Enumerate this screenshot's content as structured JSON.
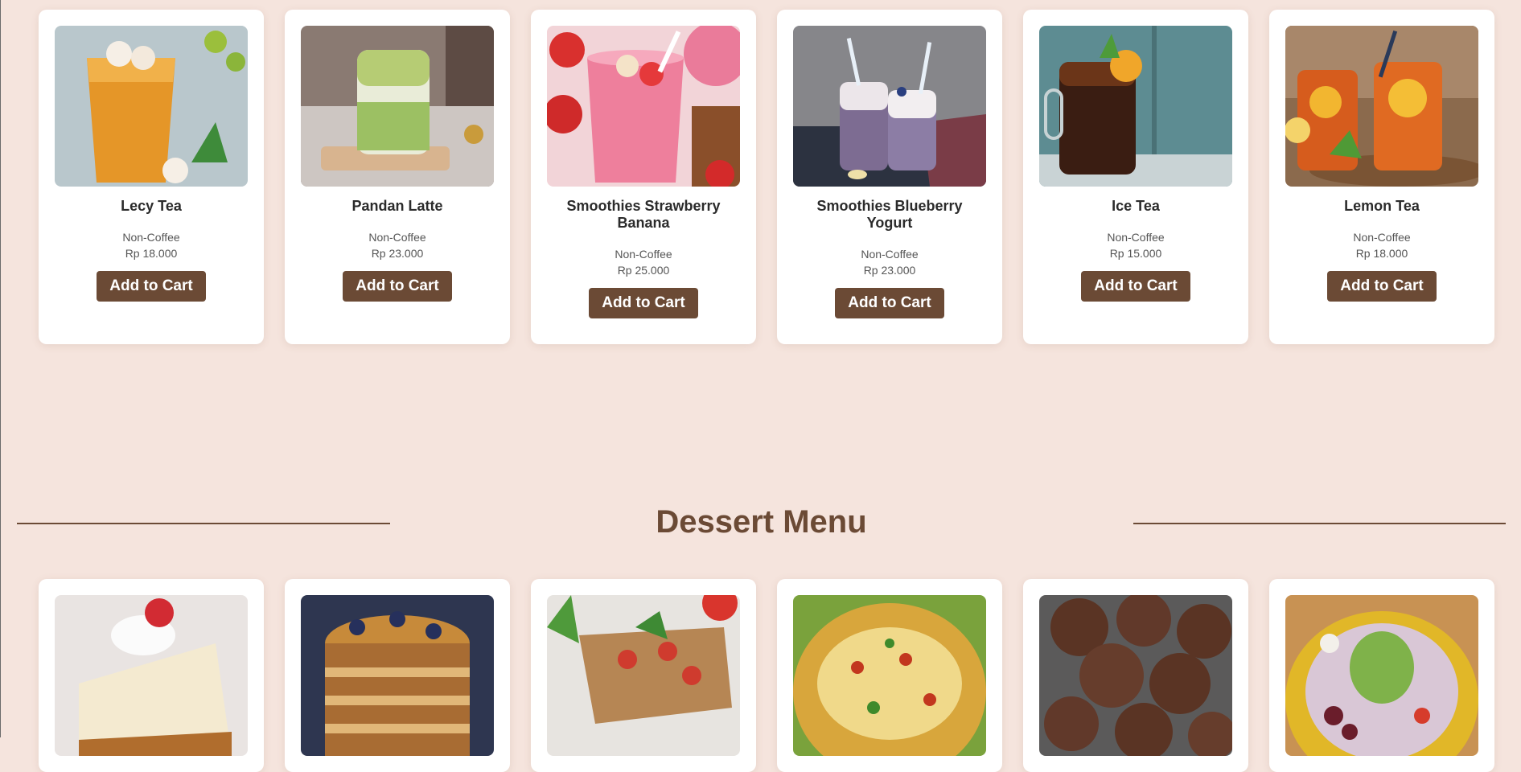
{
  "drinks": [
    {
      "name": "Lecy Tea",
      "category": "Non-Coffee",
      "price": "Rp 18.000",
      "button": "Add to Cart",
      "image_icon": "lychee-tea-image"
    },
    {
      "name": "Pandan Latte",
      "category": "Non-Coffee",
      "price": "Rp 23.000",
      "button": "Add to Cart",
      "image_icon": "pandan-latte-image"
    },
    {
      "name": "Smoothies Strawberry Banana",
      "category": "Non-Coffee",
      "price": "Rp 25.000",
      "button": "Add to Cart",
      "image_icon": "strawberry-smoothie-image"
    },
    {
      "name": "Smoothies Blueberry Yogurt",
      "category": "Non-Coffee",
      "price": "Rp 23.000",
      "button": "Add to Cart",
      "image_icon": "blueberry-smoothie-image"
    },
    {
      "name": "Ice Tea",
      "category": "Non-Coffee",
      "price": "Rp 15.000",
      "button": "Add to Cart",
      "image_icon": "ice-tea-image"
    },
    {
      "name": "Lemon Tea",
      "category": "Non-Coffee",
      "price": "Rp 18.000",
      "button": "Add to Cart",
      "image_icon": "lemon-tea-image"
    }
  ],
  "dessert_section": {
    "title": "Dessert Menu"
  },
  "desserts": [
    {
      "image_icon": "cheesecake-image"
    },
    {
      "image_icon": "blueberry-pancake-image"
    },
    {
      "image_icon": "bruschetta-image"
    },
    {
      "image_icon": "nachos-image"
    },
    {
      "image_icon": "chocolate-cookies-image"
    },
    {
      "image_icon": "ice-dessert-bowl-image"
    }
  ],
  "colors": {
    "background": "#f5e4dd",
    "accent": "#6b4a35",
    "card": "#ffffff"
  }
}
